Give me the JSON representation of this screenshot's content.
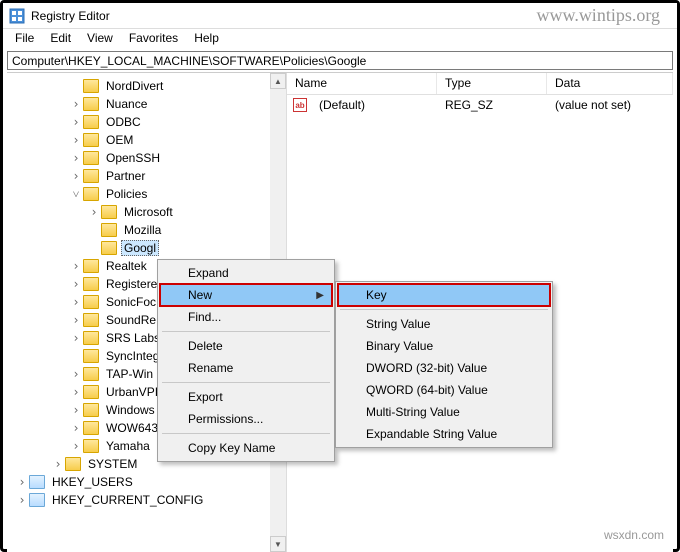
{
  "watermarks": {
    "top": "www.wintips.org",
    "bottom": "wsxdn.com"
  },
  "window": {
    "title": "Registry Editor"
  },
  "menubar": [
    "File",
    "Edit",
    "View",
    "Favorites",
    "Help"
  ],
  "addressbar": "Computer\\HKEY_LOCAL_MACHINE\\SOFTWARE\\Policies\\Google",
  "tree": {
    "items": [
      {
        "label": "NordDivert",
        "depth": 4,
        "exp": ""
      },
      {
        "label": "Nuance",
        "depth": 4,
        "exp": ">"
      },
      {
        "label": "ODBC",
        "depth": 4,
        "exp": ">"
      },
      {
        "label": "OEM",
        "depth": 4,
        "exp": ">"
      },
      {
        "label": "OpenSSH",
        "depth": 4,
        "exp": ">"
      },
      {
        "label": "Partner",
        "depth": 4,
        "exp": ">"
      },
      {
        "label": "Policies",
        "depth": 4,
        "exp": "v"
      },
      {
        "label": "Microsoft",
        "depth": 5,
        "exp": ">"
      },
      {
        "label": "Mozilla",
        "depth": 5,
        "exp": ""
      },
      {
        "label": "Google",
        "depth": 5,
        "exp": "",
        "selected": true,
        "truncated": "Googl"
      },
      {
        "label": "Realtek",
        "depth": 4,
        "exp": ">"
      },
      {
        "label": "Registere",
        "depth": 4,
        "exp": ">"
      },
      {
        "label": "SonicFoc",
        "depth": 4,
        "exp": ">"
      },
      {
        "label": "SoundRe",
        "depth": 4,
        "exp": ">"
      },
      {
        "label": "SRS Labs",
        "depth": 4,
        "exp": ">"
      },
      {
        "label": "SyncInteg",
        "depth": 4,
        "exp": ""
      },
      {
        "label": "TAP-Win",
        "depth": 4,
        "exp": ">"
      },
      {
        "label": "UrbanVPI",
        "depth": 4,
        "exp": ">"
      },
      {
        "label": "Windows",
        "depth": 4,
        "exp": ">"
      },
      {
        "label": "WOW643",
        "depth": 4,
        "exp": ">"
      },
      {
        "label": "Yamaha",
        "depth": 4,
        "exp": ">"
      },
      {
        "label": "SYSTEM",
        "depth": 3,
        "exp": ">"
      },
      {
        "label": "HKEY_USERS",
        "depth": 1,
        "exp": ">",
        "root": true
      },
      {
        "label": "HKEY_CURRENT_CONFIG",
        "depth": 1,
        "exp": ">",
        "root": true
      }
    ]
  },
  "list": {
    "columns": {
      "name": "Name",
      "type": "Type",
      "data": "Data"
    },
    "rows": [
      {
        "name": "(Default)",
        "type": "REG_SZ",
        "data": "(value not set)"
      }
    ]
  },
  "context_menu": {
    "items": [
      {
        "label": "Expand"
      },
      {
        "label": "New",
        "submenu": true,
        "highlighted": true
      },
      {
        "label": "Find..."
      },
      {
        "sep": true
      },
      {
        "label": "Delete"
      },
      {
        "label": "Rename"
      },
      {
        "sep": true
      },
      {
        "label": "Export"
      },
      {
        "label": "Permissions..."
      },
      {
        "sep": true
      },
      {
        "label": "Copy Key Name"
      }
    ],
    "submenu": [
      {
        "label": "Key",
        "highlighted": true
      },
      {
        "sep": true
      },
      {
        "label": "String Value"
      },
      {
        "label": "Binary Value"
      },
      {
        "label": "DWORD (32-bit) Value"
      },
      {
        "label": "QWORD (64-bit) Value"
      },
      {
        "label": "Multi-String Value"
      },
      {
        "label": "Expandable String Value"
      }
    ]
  }
}
